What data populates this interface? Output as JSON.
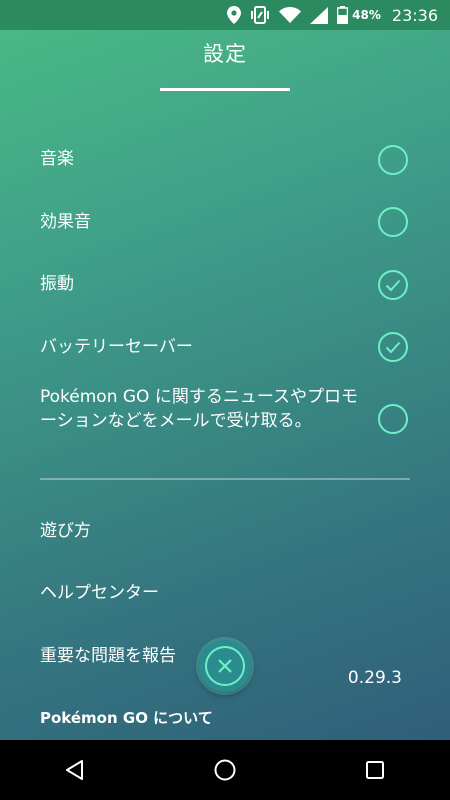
{
  "status_bar": {
    "battery_percent": "48%",
    "time": "23:36",
    "icons": [
      "location-icon",
      "vibrate-icon",
      "wifi-icon",
      "signal-icon",
      "battery-icon"
    ]
  },
  "page": {
    "title": "設定"
  },
  "settings": [
    {
      "label": "音楽",
      "checked": false
    },
    {
      "label": "効果音",
      "checked": false
    },
    {
      "label": "振動",
      "checked": true
    },
    {
      "label": "バッテリーセーバー",
      "checked": true
    },
    {
      "label": "Pokémon GO に関するニュースやプロモーションなどをメールで受け取る。",
      "checked": false
    }
  ],
  "links": {
    "how_to_play": "遊び方",
    "help_center": "ヘルプセンター",
    "report_issue": "重要な問題を報告",
    "about": "Pokémon GO について"
  },
  "version": "0.29.3",
  "colors": {
    "accent": "#6ff0c4",
    "status_bar": "#2c8a60",
    "fab": "#2a8c8f"
  },
  "nav_bar": {
    "icons": [
      "back-icon",
      "home-icon",
      "recents-icon"
    ]
  }
}
